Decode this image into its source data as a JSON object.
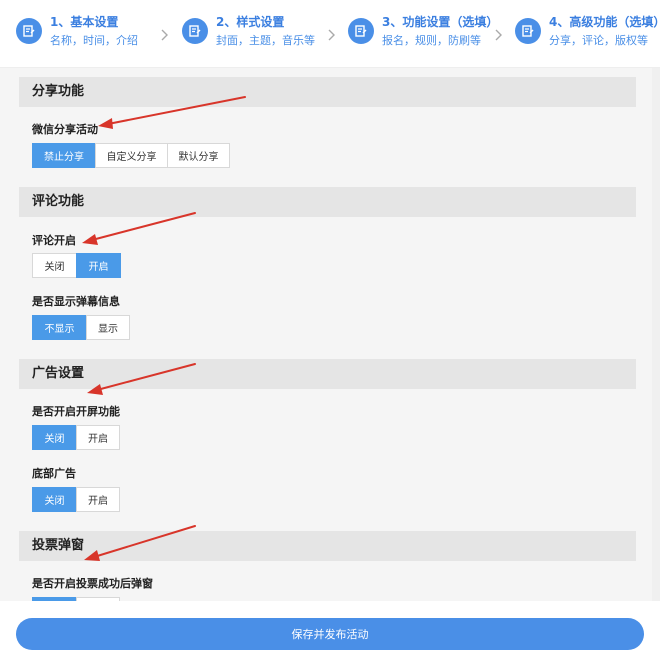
{
  "steps": [
    {
      "title": "1、基本设置",
      "sub": "名称，时间，介绍"
    },
    {
      "title": "2、样式设置",
      "sub": "封面，主题，音乐等"
    },
    {
      "title": "3、功能设置（选填）",
      "sub": "报名，规则，防刷等"
    },
    {
      "title": "4、高级功能（选填）",
      "sub": "分享，评论，版权等"
    }
  ],
  "sections": {
    "share": {
      "title": "分享功能",
      "wechat_label": "微信分享活动",
      "options": [
        "禁止分享",
        "自定义分享",
        "默认分享"
      ]
    },
    "comment": {
      "title": "评论功能",
      "enable_label": "评论开启",
      "enable_options": [
        "关闭",
        "开启"
      ],
      "danmaku_label": "是否显示弹幕信息",
      "danmaku_options": [
        "不显示",
        "显示"
      ]
    },
    "ad": {
      "title": "广告设置",
      "splash_label": "是否开启开屏功能",
      "splash_options": [
        "关闭",
        "开启"
      ],
      "bottom_label": "底部广告",
      "bottom_options": [
        "关闭",
        "开启"
      ]
    },
    "vote": {
      "title": "投票弹窗",
      "popup_label": "是否开启投票成功后弹窗"
    }
  },
  "footer": {
    "save_label": "保存并发布活动"
  },
  "colors": {
    "accent": "#4a8fe7",
    "active_button": "#4a9ae8",
    "arrow": "#d8352a"
  }
}
